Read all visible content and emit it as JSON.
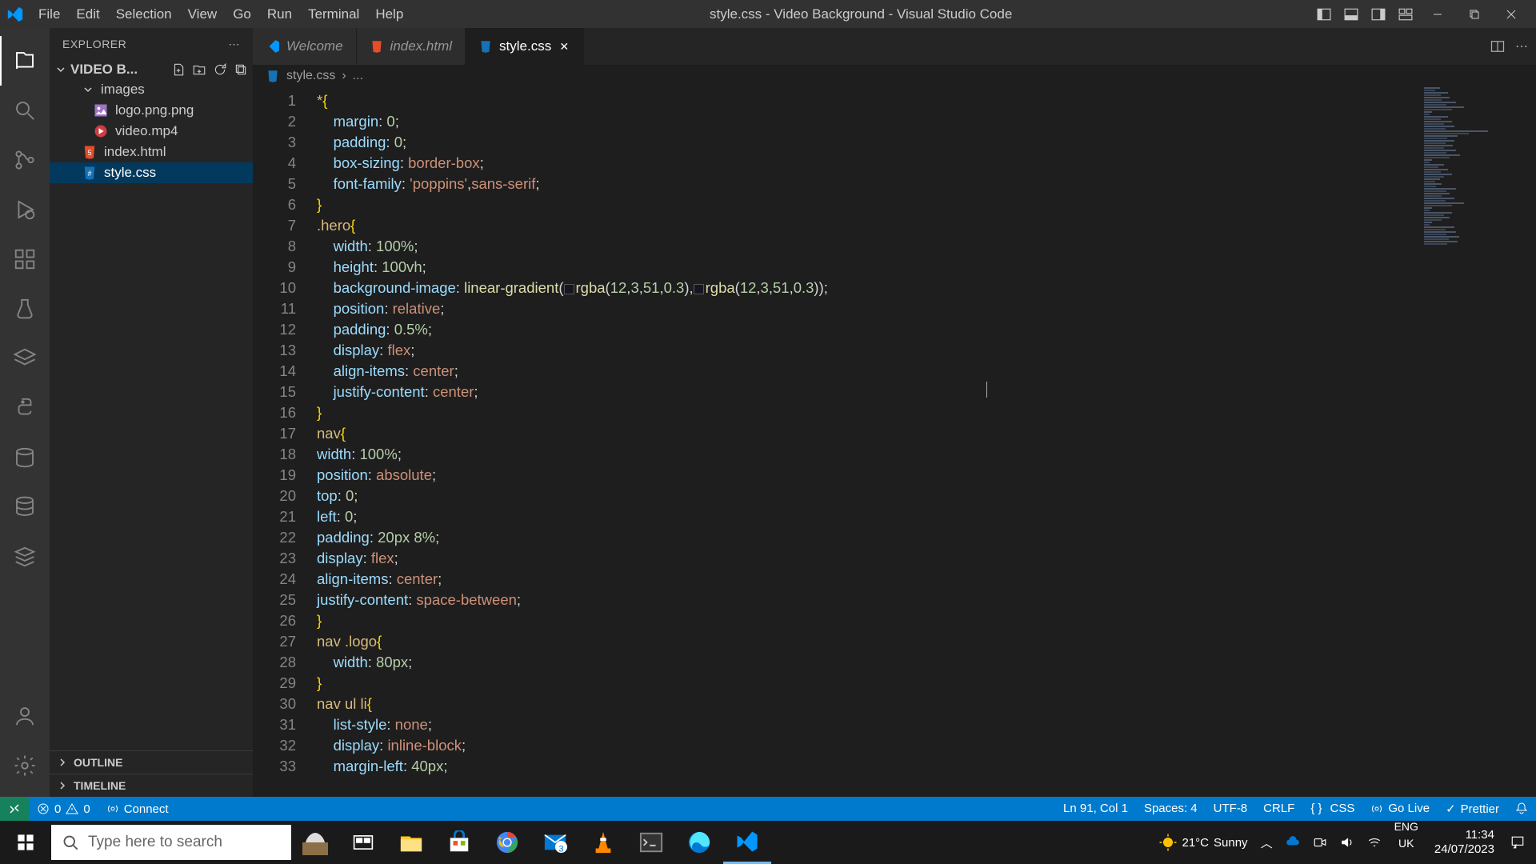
{
  "titlebar": {
    "menus": [
      "File",
      "Edit",
      "Selection",
      "View",
      "Go",
      "Run",
      "Terminal",
      "Help"
    ],
    "title": "style.css - Video Background - Visual Studio Code"
  },
  "sidebar": {
    "header": "EXPLORER",
    "project": "VIDEO B...",
    "folders": {
      "images": "images"
    },
    "files": {
      "logo": "logo.png.png",
      "video": "video.mp4",
      "index": "index.html",
      "style": "style.css"
    },
    "outline": "OUTLINE",
    "timeline": "TIMELINE"
  },
  "tabs": {
    "welcome": "Welcome",
    "index": "index.html",
    "style": "style.css"
  },
  "breadcrumb": {
    "file": "style.css",
    "sep": "›",
    "context": "..."
  },
  "code": {
    "lines": [
      {
        "n": 1,
        "tokens": [
          [
            "*",
            "sel"
          ],
          [
            "{",
            "brace"
          ]
        ]
      },
      {
        "n": 2,
        "indent": "    ",
        "tokens": [
          [
            "margin",
            "prop"
          ],
          [
            ": ",
            "punc"
          ],
          [
            "0",
            "num"
          ],
          [
            ";",
            "punc"
          ]
        ]
      },
      {
        "n": 3,
        "indent": "    ",
        "tokens": [
          [
            "padding",
            "prop"
          ],
          [
            ": ",
            "punc"
          ],
          [
            "0",
            "num"
          ],
          [
            ";",
            "punc"
          ]
        ]
      },
      {
        "n": 4,
        "indent": "    ",
        "tokens": [
          [
            "box-sizing",
            "prop"
          ],
          [
            ": ",
            "punc"
          ],
          [
            "border-box",
            "val"
          ],
          [
            ";",
            "punc"
          ]
        ]
      },
      {
        "n": 5,
        "indent": "    ",
        "tokens": [
          [
            "font-family",
            "prop"
          ],
          [
            ": ",
            "punc"
          ],
          [
            "'poppins'",
            "val"
          ],
          [
            ",",
            "punc"
          ],
          [
            "sans-serif",
            "val"
          ],
          [
            ";",
            "punc"
          ]
        ]
      },
      {
        "n": 6,
        "tokens": [
          [
            "}",
            "brace"
          ]
        ]
      },
      {
        "n": 7,
        "tokens": [
          [
            ".hero",
            "sel"
          ],
          [
            "{",
            "brace"
          ]
        ]
      },
      {
        "n": 8,
        "indent": "    ",
        "tokens": [
          [
            "width",
            "prop"
          ],
          [
            ": ",
            "punc"
          ],
          [
            "100%",
            "num"
          ],
          [
            ";",
            "punc"
          ]
        ]
      },
      {
        "n": 9,
        "indent": "    ",
        "tokens": [
          [
            "height",
            "prop"
          ],
          [
            ": ",
            "punc"
          ],
          [
            "100vh",
            "num"
          ],
          [
            ";",
            "punc"
          ]
        ]
      },
      {
        "n": 10,
        "indent": "    ",
        "tokens": [
          [
            "background-image",
            "prop"
          ],
          [
            ": ",
            "punc"
          ],
          [
            "linear-gradient",
            "func"
          ],
          [
            "(",
            "punc"
          ],
          [
            "SWATCH",
            "swatch"
          ],
          [
            "rgba",
            "func"
          ],
          [
            "(",
            "punc"
          ],
          [
            "12",
            "num"
          ],
          [
            ",",
            "punc"
          ],
          [
            "3",
            "num"
          ],
          [
            ",",
            "punc"
          ],
          [
            "51",
            "num"
          ],
          [
            ",",
            "punc"
          ],
          [
            "0.3",
            "num"
          ],
          [
            "),",
            "punc"
          ],
          [
            "SWATCH",
            "swatch"
          ],
          [
            "rgba",
            "func"
          ],
          [
            "(",
            "punc"
          ],
          [
            "12",
            "num"
          ],
          [
            ",",
            "punc"
          ],
          [
            "3",
            "num"
          ],
          [
            ",",
            "punc"
          ],
          [
            "51",
            "num"
          ],
          [
            ",",
            "punc"
          ],
          [
            "0.3",
            "num"
          ],
          [
            "));",
            "punc"
          ]
        ]
      },
      {
        "n": 11,
        "indent": "    ",
        "tokens": [
          [
            "position",
            "prop"
          ],
          [
            ": ",
            "punc"
          ],
          [
            "relative",
            "val"
          ],
          [
            ";",
            "punc"
          ]
        ]
      },
      {
        "n": 12,
        "indent": "    ",
        "tokens": [
          [
            "padding",
            "prop"
          ],
          [
            ": ",
            "punc"
          ],
          [
            "0.5%",
            "num"
          ],
          [
            ";",
            "punc"
          ]
        ]
      },
      {
        "n": 13,
        "indent": "    ",
        "tokens": [
          [
            "display",
            "prop"
          ],
          [
            ": ",
            "punc"
          ],
          [
            "flex",
            "val"
          ],
          [
            ";",
            "punc"
          ]
        ]
      },
      {
        "n": 14,
        "indent": "    ",
        "tokens": [
          [
            "align-items",
            "prop"
          ],
          [
            ": ",
            "punc"
          ],
          [
            "center",
            "val"
          ],
          [
            ";",
            "punc"
          ]
        ]
      },
      {
        "n": 15,
        "indent": "    ",
        "tokens": [
          [
            "justify-content",
            "prop"
          ],
          [
            ": ",
            "punc"
          ],
          [
            "center",
            "val"
          ],
          [
            ";",
            "punc"
          ]
        ]
      },
      {
        "n": 16,
        "tokens": [
          [
            "}",
            "brace"
          ]
        ]
      },
      {
        "n": 17,
        "tokens": [
          [
            "nav",
            "sel"
          ],
          [
            "{",
            "brace"
          ]
        ]
      },
      {
        "n": 18,
        "tokens": [
          [
            "width",
            "prop"
          ],
          [
            ": ",
            "punc"
          ],
          [
            "100%",
            "num"
          ],
          [
            ";",
            "punc"
          ]
        ]
      },
      {
        "n": 19,
        "tokens": [
          [
            "position",
            "prop"
          ],
          [
            ": ",
            "punc"
          ],
          [
            "absolute",
            "val"
          ],
          [
            ";",
            "punc"
          ]
        ]
      },
      {
        "n": 20,
        "tokens": [
          [
            "top",
            "prop"
          ],
          [
            ": ",
            "punc"
          ],
          [
            "0",
            "num"
          ],
          [
            ";",
            "punc"
          ]
        ]
      },
      {
        "n": 21,
        "tokens": [
          [
            "left",
            "prop"
          ],
          [
            ": ",
            "punc"
          ],
          [
            "0",
            "num"
          ],
          [
            ";",
            "punc"
          ]
        ]
      },
      {
        "n": 22,
        "tokens": [
          [
            "padding",
            "prop"
          ],
          [
            ": ",
            "punc"
          ],
          [
            "20px",
            "num"
          ],
          [
            " ",
            "punc"
          ],
          [
            "8%",
            "num"
          ],
          [
            ";",
            "punc"
          ]
        ]
      },
      {
        "n": 23,
        "tokens": [
          [
            "display",
            "prop"
          ],
          [
            ": ",
            "punc"
          ],
          [
            "flex",
            "val"
          ],
          [
            ";",
            "punc"
          ]
        ]
      },
      {
        "n": 24,
        "tokens": [
          [
            "align-items",
            "prop"
          ],
          [
            ": ",
            "punc"
          ],
          [
            "center",
            "val"
          ],
          [
            ";",
            "punc"
          ]
        ]
      },
      {
        "n": 25,
        "tokens": [
          [
            "justify-content",
            "prop"
          ],
          [
            ": ",
            "punc"
          ],
          [
            "space-between",
            "val"
          ],
          [
            ";",
            "punc"
          ]
        ]
      },
      {
        "n": 26,
        "tokens": [
          [
            "}",
            "brace"
          ]
        ]
      },
      {
        "n": 27,
        "tokens": [
          [
            "nav .logo",
            "sel"
          ],
          [
            "{",
            "brace"
          ]
        ]
      },
      {
        "n": 28,
        "indent": "    ",
        "tokens": [
          [
            "width",
            "prop"
          ],
          [
            ": ",
            "punc"
          ],
          [
            "80px",
            "num"
          ],
          [
            ";",
            "punc"
          ]
        ]
      },
      {
        "n": 29,
        "tokens": [
          [
            "}",
            "brace"
          ]
        ]
      },
      {
        "n": 30,
        "tokens": [
          [
            "nav ul li",
            "sel"
          ],
          [
            "{",
            "brace"
          ]
        ]
      },
      {
        "n": 31,
        "indent": "    ",
        "tokens": [
          [
            "list-style",
            "prop"
          ],
          [
            ": ",
            "punc"
          ],
          [
            "none",
            "val"
          ],
          [
            ";",
            "punc"
          ]
        ]
      },
      {
        "n": 32,
        "indent": "    ",
        "tokens": [
          [
            "display",
            "prop"
          ],
          [
            ": ",
            "punc"
          ],
          [
            "inline-block",
            "val"
          ],
          [
            ";",
            "punc"
          ]
        ]
      },
      {
        "n": 33,
        "indent": "    ",
        "tokens": [
          [
            "margin-left",
            "prop"
          ],
          [
            ": ",
            "punc"
          ],
          [
            "40px",
            "num"
          ],
          [
            ";",
            "punc"
          ]
        ]
      }
    ]
  },
  "statusbar": {
    "errors": "0",
    "warnings": "0",
    "connect": "Connect",
    "ln": "Ln 91, Col 1",
    "spaces": "Spaces: 4",
    "encoding": "UTF-8",
    "eol": "CRLF",
    "lang": "CSS",
    "golive": "Go Live",
    "prettier": "Prettier"
  },
  "taskbar": {
    "search": "Type here to search",
    "weather_temp": "21°C",
    "weather_desc": "Sunny",
    "lang1": "ENG",
    "lang2": "UK",
    "time": "11:34",
    "date": "24/07/2023"
  }
}
